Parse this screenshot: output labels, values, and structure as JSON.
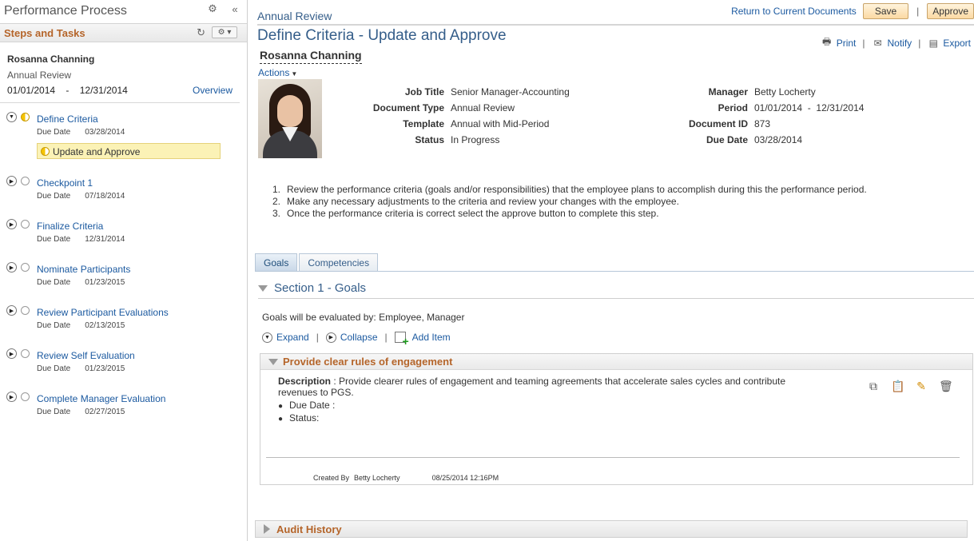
{
  "left_panel": {
    "title": "Performance Process",
    "icons": {
      "settings": "gear-icon",
      "collapse": "double-chevron-left-icon"
    },
    "steps_header": {
      "title": "Steps and Tasks",
      "refresh": "refresh-icon",
      "menu": "gear-dropdown-icon"
    },
    "employee": {
      "name": "Rosanna Channing",
      "document": "Annual Review",
      "start": "01/01/2014",
      "separator": "-",
      "end": "12/31/2014",
      "overview": "Overview"
    },
    "due_label": "Due Date",
    "steps": [
      {
        "label": "Define Criteria",
        "due": "03/28/2014",
        "status": "in-progress",
        "expanded": true
      },
      {
        "label": "Checkpoint 1",
        "due": "07/18/2014",
        "status": "not-started",
        "expanded": false
      },
      {
        "label": "Finalize Criteria",
        "due": "12/31/2014",
        "status": "not-started",
        "expanded": false
      },
      {
        "label": "Nominate Participants",
        "due": "01/23/2015",
        "status": "not-started",
        "expanded": false
      },
      {
        "label": "Review Participant Evaluations",
        "due": "02/13/2015",
        "status": "not-started",
        "expanded": false
      },
      {
        "label": "Review Self Evaluation",
        "due": "01/23/2015",
        "status": "not-started",
        "expanded": false
      },
      {
        "label": "Complete Manager Evaluation",
        "due": "02/27/2015",
        "status": "not-started",
        "expanded": false
      }
    ],
    "current_task": "Update and Approve"
  },
  "header": {
    "breadcrumb": "Annual Review",
    "return_link": "Return to Current Documents",
    "save": "Save",
    "bar": "|",
    "approve": "Approve"
  },
  "page": {
    "title": "Define Criteria - Update and Approve",
    "print": "Print",
    "notify": "Notify",
    "export": "Export",
    "employee_name": "Rosanna Channing",
    "actions": "Actions"
  },
  "details": {
    "left": [
      {
        "label": "Job Title",
        "value": "Senior Manager-Accounting"
      },
      {
        "label": "Document Type",
        "value": "Annual Review"
      },
      {
        "label": "Template",
        "value": "Annual with Mid-Period"
      },
      {
        "label": "Status",
        "value": "In Progress"
      }
    ],
    "right": [
      {
        "label": "Manager",
        "value": "Betty Locherty"
      },
      {
        "label": "Period",
        "value": "01/01/2014  -  12/31/2014"
      },
      {
        "label": "Document ID",
        "value": "873"
      },
      {
        "label": "Due Date",
        "value": "03/28/2014"
      }
    ]
  },
  "instructions": [
    {
      "n": "1.",
      "text": "Review the performance criteria (goals and/or responsibilities) that the employee plans to accomplish during this the performance period."
    },
    {
      "n": "2.",
      "text": "Make any necessary adjustments to the criteria and review your changes with the employee."
    },
    {
      "n": "3.",
      "text": "Once the performance criteria is correct select the approve button to complete this step."
    }
  ],
  "tabs": [
    {
      "label": "Goals",
      "active": true
    },
    {
      "label": "Competencies",
      "active": false
    }
  ],
  "section": {
    "title": "Section 1 - Goals",
    "evaluated_by": "Goals will be evaluated by: Employee, Manager",
    "expand": "Expand",
    "collapse": "Collapse",
    "add_item": "Add Item"
  },
  "goal": {
    "title": "Provide clear rules of engagement",
    "description_label": "Description",
    "description": " : Provide clearer rules of engagement and teaming agreements that accelerate sales cycles and contribute revenues to PGS.",
    "due_date_label": "Due Date :",
    "status_label": "Status:",
    "created_by_label": "Created By",
    "created_by": "Betty Locherty",
    "created_at": "08/25/2014 12:16PM"
  },
  "audit": {
    "title": "Audit History"
  }
}
